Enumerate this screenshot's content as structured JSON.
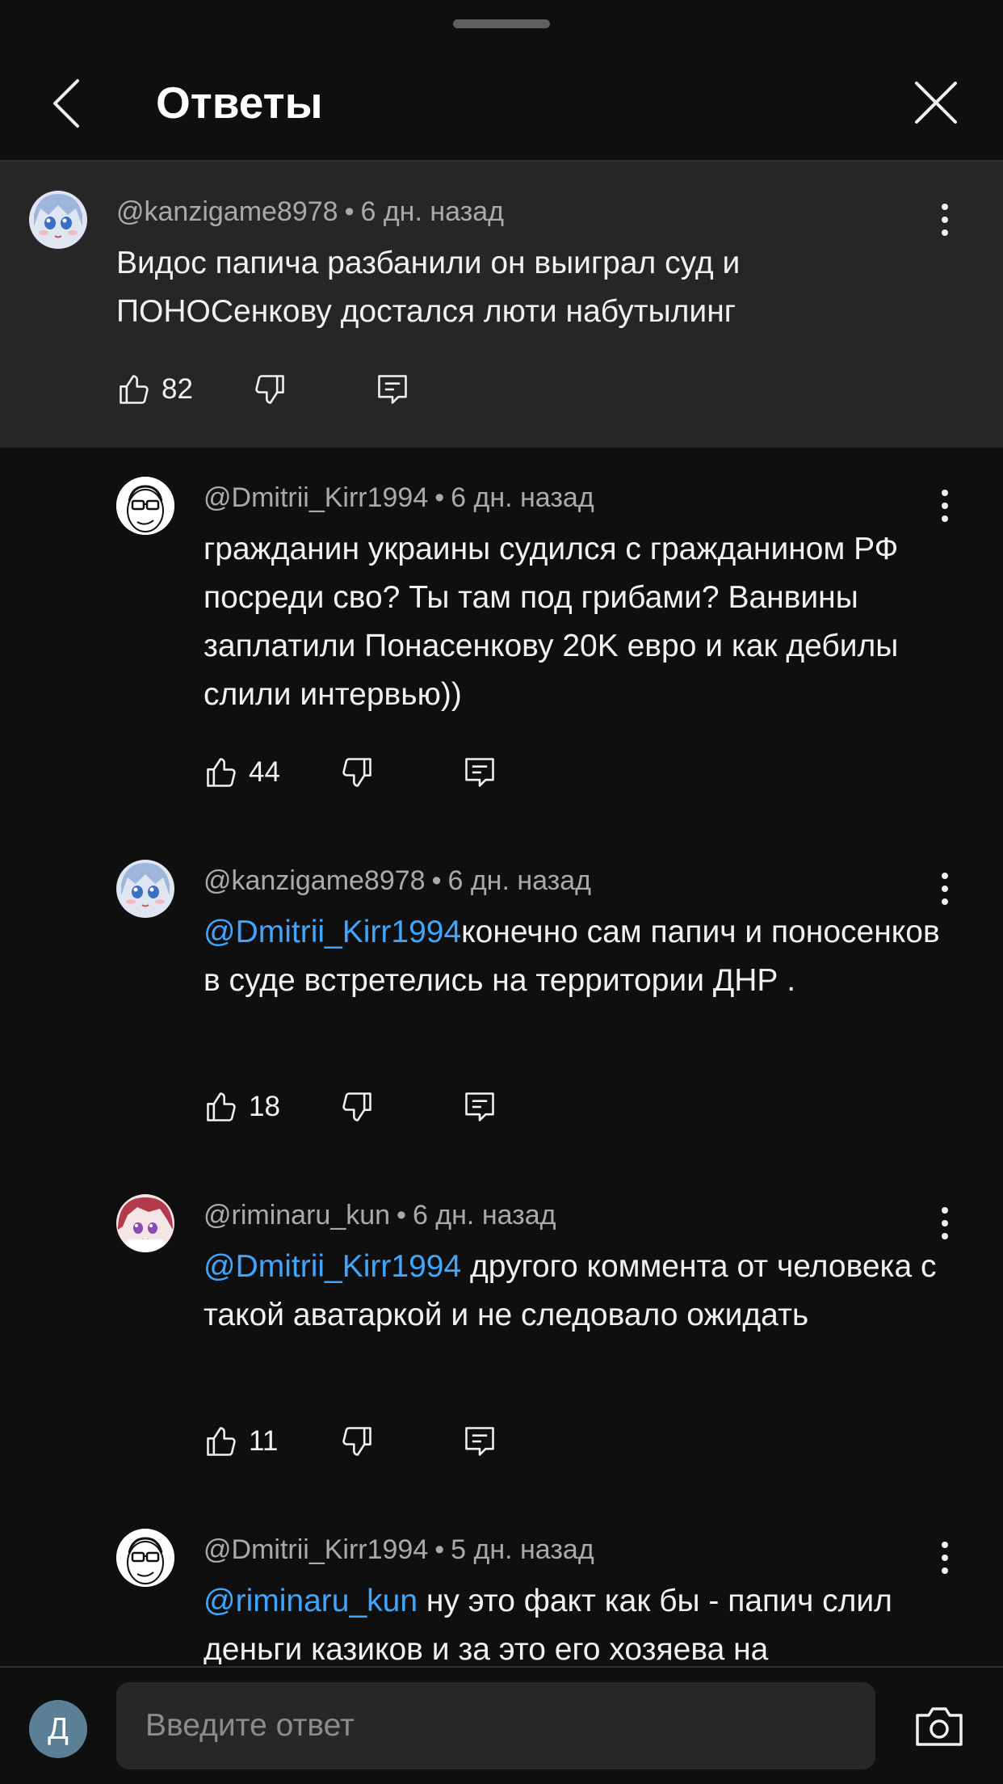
{
  "header": {
    "title": "Ответы"
  },
  "comments": [
    {
      "author": "@kanzigame8978",
      "time": "6 дн. назад",
      "mention": "",
      "text": "Видос папича разбанили он выиграл суд и ПОНОСенкову достался люти набутылинг",
      "likes": "82"
    },
    {
      "author": "@Dmitrii_Kirr1994",
      "time": "6 дн. назад",
      "mention": "",
      "text": "гражданин украины судился с гражданином РФ посреди сво? Ты там под грибами? Ванвины заплатили Понасенкову 20K евро и как дебилы слили интервью))",
      "likes": "44"
    },
    {
      "author": "@kanzigame8978",
      "time": "6 дн. назад",
      "mention": "@Dmitrii_Kirr1994",
      "text": "конечно сам папич и поносенков в суде встретелись на территории ДНР .",
      "likes": "18"
    },
    {
      "author": "@riminaru_kun",
      "time": "6 дн. назад",
      "mention": "@Dmitrii_Kirr1994",
      "text": " другого коммента от человека с такой аватаркой и не следовало ожидать",
      "likes": "11"
    },
    {
      "author": "@Dmitrii_Kirr1994",
      "time": "5 дн. назад",
      "mention": "@riminaru_kun",
      "text": " ну это факт как бы - папич слил деньги казиков и за это его хозяева на",
      "likes": ""
    }
  ],
  "bottom": {
    "avatar_letter": "Д",
    "reply_placeholder": "Введите ответ"
  },
  "icons": {
    "back": "chevron-left-icon",
    "close": "close-icon",
    "like": "thumb-up-icon",
    "dislike": "thumb-down-icon",
    "reply": "reply-comment-icon",
    "more": "more-vertical-icon",
    "camera": "camera-icon"
  },
  "colors": {
    "background": "#0f0f0f",
    "parent_highlight": "#262626",
    "mention": "#3ea6ff",
    "meta_text": "#aaaaaa"
  }
}
